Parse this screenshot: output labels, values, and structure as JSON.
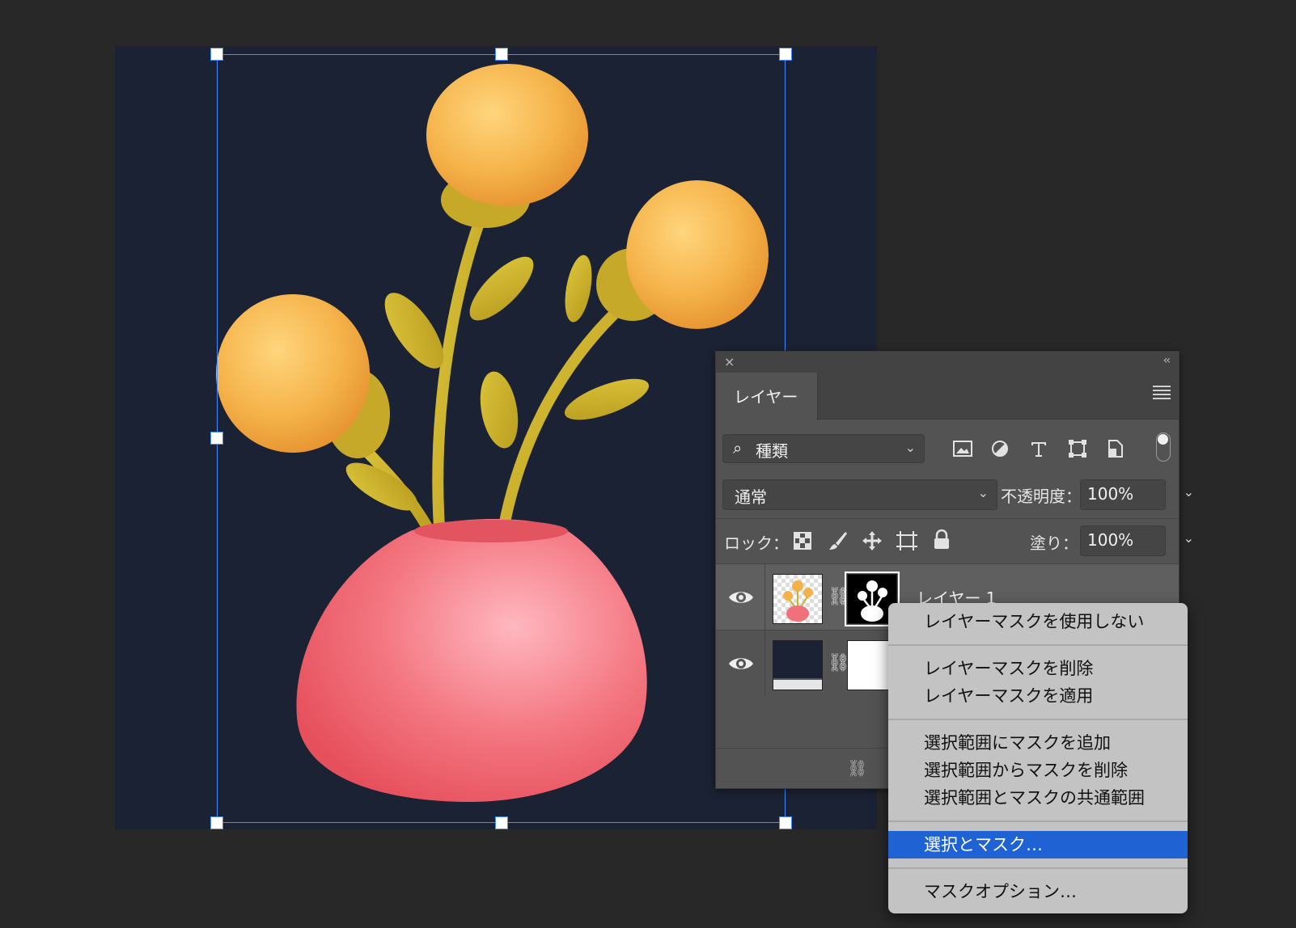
{
  "panel": {
    "close": "×",
    "collapse": "‹‹",
    "tab": "レイヤー",
    "filter": {
      "label": "種類"
    },
    "blend_mode": "通常",
    "opacity_label": "不透明度：",
    "opacity_value": "100%",
    "lock_label": "ロック：",
    "fill_label": "塗り：",
    "fill_value": "100%",
    "layers": [
      {
        "name": "レイヤー 1",
        "visible": true,
        "has_mask": true
      },
      {
        "name": "",
        "visible": true,
        "has_mask": true
      }
    ]
  },
  "context_menu": {
    "items": [
      {
        "label": "レイヤーマスクを使用しない"
      },
      {
        "label": "レイヤーマスクを削除"
      },
      {
        "label": "レイヤーマスクを適用"
      },
      {
        "label": "選択範囲にマスクを追加"
      },
      {
        "label": "選択範囲からマスクを削除"
      },
      {
        "label": "選択範囲とマスクの共通範囲"
      },
      {
        "label": "選択とマスク…",
        "selected": true
      },
      {
        "label": "マスクオプション…"
      }
    ]
  },
  "colors": {
    "selection_blue": "#1f62d3",
    "bbox_blue": "#4a8cff",
    "canvas_bg": "#1b2233",
    "flower": "#f3b24a",
    "vase": "#f0707c",
    "stem": "#c9b12c"
  }
}
